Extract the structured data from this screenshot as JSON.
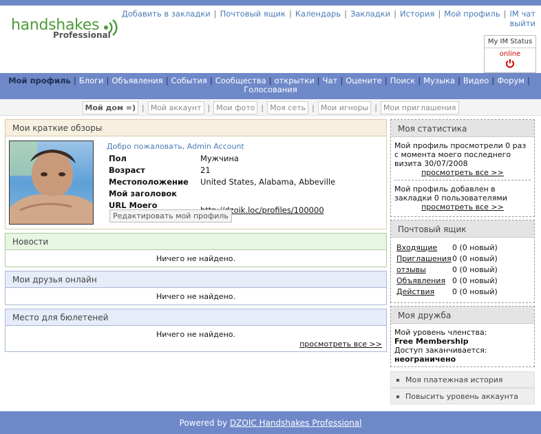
{
  "colors": {
    "brand": "#6e88c8",
    "logo_green": "#4f9a3b",
    "link": "#4a7bb5",
    "online": "#cc0000"
  },
  "logo": {
    "word": "handshakes",
    "sub": "Professional"
  },
  "toplinks": [
    "Добавить в закладки",
    "Почтовый ящик",
    "Календарь",
    "Закладки",
    "История",
    "Мой профиль",
    "IM чат",
    "выйти"
  ],
  "im_status": {
    "title": "My IM Status",
    "state": "online",
    "icon": "power-icon"
  },
  "mainnav": {
    "items": [
      "Мой профиль",
      "Блоги",
      "Объявления",
      "События",
      "Сообщества",
      "открытки",
      "Чат",
      "Оцените",
      "Поиск",
      "Музыка",
      "Видео",
      "Форум",
      "Голосования"
    ],
    "current": "Мой профиль"
  },
  "subnav": {
    "items": [
      "Мой дом =)",
      "Мой аккаунт",
      "Мои фото",
      "Моя сеть",
      "Мои игноры",
      "Мои приглашения"
    ],
    "current": "Мой дом =)"
  },
  "overview": {
    "title": "Мои краткие обзоры",
    "welcome": "Добро пожаловать, Admin Account",
    "rows": [
      {
        "k": "Пол",
        "v": "Мужчина"
      },
      {
        "k": "Возраст",
        "v": "21"
      },
      {
        "k": "Местоположение",
        "v": "United States, Alabama, Abbeville"
      },
      {
        "k": "Мой заголовок",
        "v": ""
      },
      {
        "k": "URL Моего Профиля",
        "v": "http://dzoik.loc/profiles/100000"
      }
    ],
    "edit_button": "Редактировать мой профиль"
  },
  "news": {
    "title": "Новости",
    "empty": "Ничего не найдено."
  },
  "friends": {
    "title": "Мои друзья онлайн",
    "empty": "Ничего не найдено."
  },
  "bulletin": {
    "title": "Место для бюлетеней",
    "empty": "Ничего не найдено.",
    "view_all": "просмотреть все >>"
  },
  "stats": {
    "title": "Моя статистика",
    "views": "Мой профиль просмотрели 0 раз с момента моего последнего визита 30/07/2008",
    "views_link": "просмотреть все >>",
    "bookmarks": "Мой профиль добавлен в закладки 0 пользователями",
    "bookmarks_link": "просмотреть все >>"
  },
  "mailbox": {
    "title": "Почтовый ящик",
    "rows": [
      {
        "label": "Входящие",
        "value": "0 (0 новый)"
      },
      {
        "label": "Приглашения",
        "value": "0 (0 новый)"
      },
      {
        "label": "отзывы",
        "value": "0 (0 новый)"
      },
      {
        "label": "Объявления",
        "value": "0 (0 новый)"
      },
      {
        "label": "Действия",
        "value": "0 (0 новый)"
      }
    ]
  },
  "friendship": {
    "title": "Моя дружба",
    "level_label": "Мой уровень членства:",
    "level": "Free Membership",
    "expires_label": "Доступ заканчивается:",
    "expires": "неограничено"
  },
  "account_links": [
    "Моя платежная история",
    "Повысить уровень аккаунта"
  ],
  "footer": {
    "prefix": "Powered by ",
    "link": "DZOIC Handshakes Professional"
  }
}
